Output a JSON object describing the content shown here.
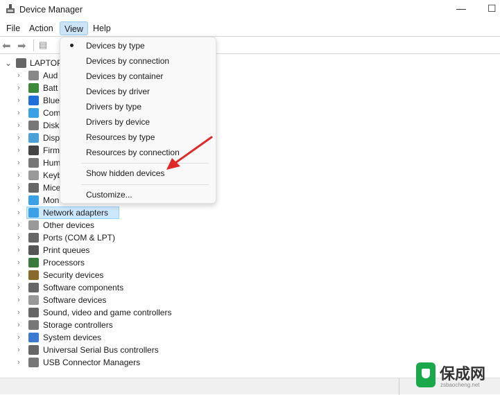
{
  "window": {
    "title": "Device Manager",
    "minimize_icon": "minimize-icon",
    "maximize_icon": "maximize-icon"
  },
  "menubar": [
    "File",
    "Action",
    "View",
    "Help"
  ],
  "tree": {
    "root": "LAPTOP",
    "items": [
      "Aud",
      "Batt",
      "Blue",
      "Com",
      "Disk",
      "Disp",
      "Firm",
      "Hum",
      "Keyb",
      "Mice",
      "Mon",
      "Network adapters",
      "Other devices",
      "Ports (COM & LPT)",
      "Print queues",
      "Processors",
      "Security devices",
      "Software components",
      "Software devices",
      "Sound, video and game controllers",
      "Storage controllers",
      "System devices",
      "Universal Serial Bus controllers",
      "USB Connector Managers"
    ],
    "selected": "Network adapters"
  },
  "view_menu": {
    "items": [
      "Devices by type",
      "Devices by connection",
      "Devices by container",
      "Devices by driver",
      "Drivers by type",
      "Drivers by device",
      "Resources by type",
      "Resources by connection"
    ],
    "checked": "Devices by type",
    "show_hidden": "Show hidden devices",
    "customize": "Customize..."
  },
  "watermark": {
    "brand": "保成网",
    "domain": "zsbaocheng.net",
    "color": "#1aa84a"
  },
  "colors": {
    "arrow": "#e02a2a",
    "selection": "#cce8ff"
  }
}
